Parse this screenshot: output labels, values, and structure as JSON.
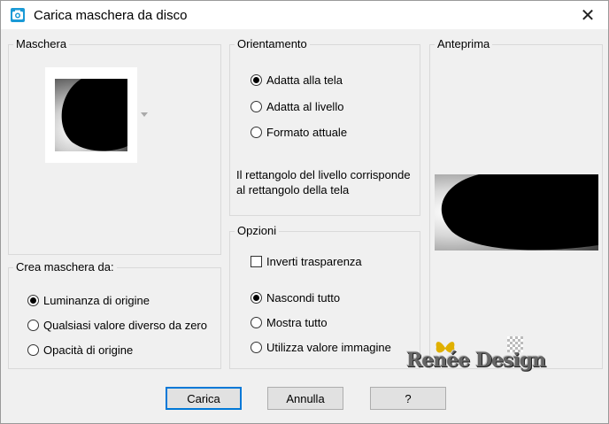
{
  "window": {
    "title": "Carica maschera da disco",
    "close_glyph": "✕",
    "app_icon": "camera-app-icon",
    "accent": "#0078d7"
  },
  "mask_group": {
    "label": "Maschera"
  },
  "create_group": {
    "label": "Crea maschera da:",
    "options": [
      {
        "label": "Luminanza di origine",
        "checked": true
      },
      {
        "label": "Qualsiasi valore diverso da zero",
        "checked": false
      },
      {
        "label": "Opacità di origine",
        "checked": false
      }
    ]
  },
  "orientation_group": {
    "label": "Orientamento",
    "options": [
      {
        "label": "Adatta alla tela",
        "checked": true
      },
      {
        "label": "Adatta al livello",
        "checked": false
      },
      {
        "label": "Formato attuale",
        "checked": false
      }
    ],
    "description": "Il rettangolo del livello corrisponde al rettangolo della tela"
  },
  "options_group": {
    "label": "Opzioni",
    "invert_label": "Inverti trasparenza",
    "invert_checked": false,
    "options": [
      {
        "label": "Nascondi tutto",
        "checked": true
      },
      {
        "label": "Mostra tutto",
        "checked": false
      },
      {
        "label": "Utilizza valore immagine",
        "checked": false
      }
    ]
  },
  "preview_group": {
    "label": "Anteprima"
  },
  "buttons": {
    "load": "Carica",
    "cancel": "Annulla",
    "help": "?"
  },
  "watermark": {
    "text": "Renée Design"
  }
}
